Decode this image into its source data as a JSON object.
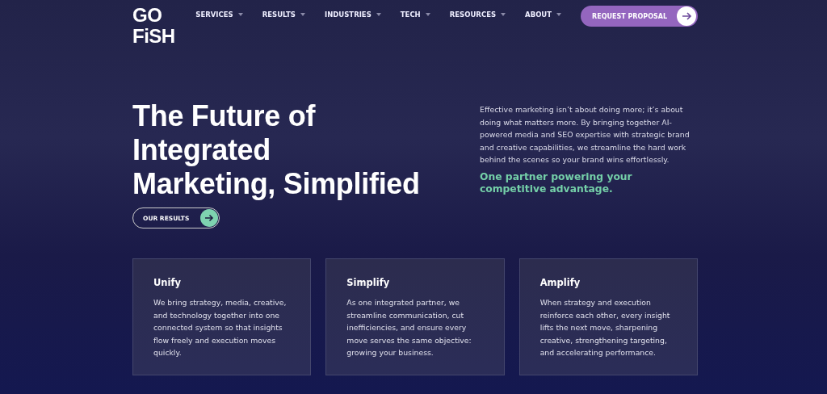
{
  "logo": [
    "GO",
    "FiSH"
  ],
  "nav": [
    {
      "label": "SERVICES"
    },
    {
      "label": "RESULTS"
    },
    {
      "label": "INDUSTRIES"
    },
    {
      "label": "TECH"
    },
    {
      "label": "RESOURCES"
    },
    {
      "label": "ABOUT"
    }
  ],
  "cta": "REQUEST PROPOSAL",
  "hero": {
    "title": [
      "The Future of",
      "Integrated",
      "Marketing, Simplified"
    ],
    "button": "OUR RESULTS",
    "body": "Effective marketing isn’t about doing more; it’s about doing what matters more. By bringing together AI-powered media and SEO expertise with strategic brand and creative capabilities, we streamline the hard work behind the scenes so your brand wins effortlessly.",
    "tagline": "One partner powering your competitive advantage."
  },
  "cards": [
    {
      "title": "Unify",
      "text": "We bring strategy, media, creative, and technology together into one connected system so that insights flow freely and execution moves quickly."
    },
    {
      "title": "Simplify",
      "text": "As one integrated partner, we streamline communication, cut inefficiencies, and ensure every move serves the same objective: growing your business."
    },
    {
      "title": "Amplify",
      "text": "When strategy and execution reinforce each other, every insight lifts the next move, sharpening creative, strengthening targeting, and accelerating performance."
    }
  ]
}
